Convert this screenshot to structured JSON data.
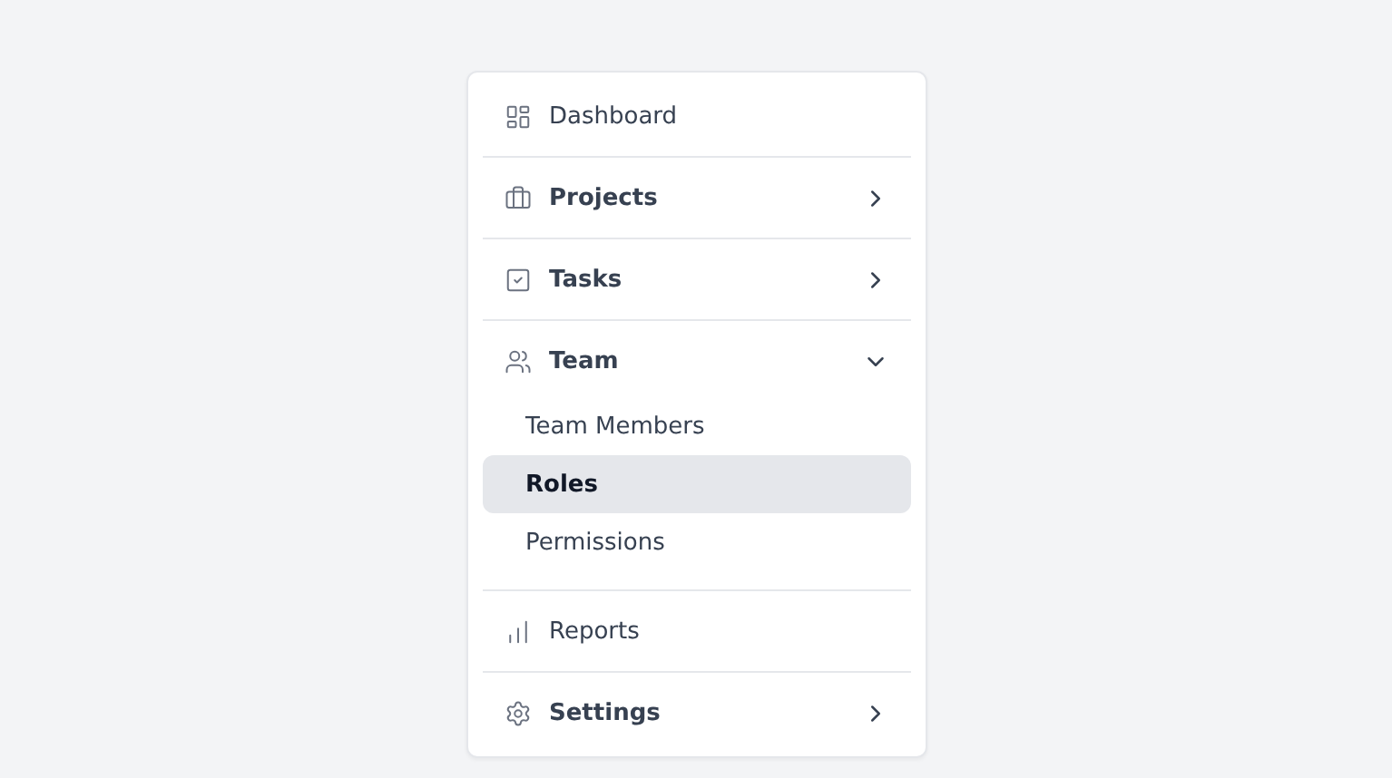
{
  "menu": [
    {
      "label": "Dashboard",
      "kind": "link"
    },
    {
      "label": "Projects",
      "kind": "group",
      "expanded": false
    },
    {
      "label": "Tasks",
      "kind": "group",
      "expanded": false
    },
    {
      "label": "Team",
      "kind": "group",
      "expanded": true,
      "children": [
        {
          "label": "Team Members",
          "selected": false
        },
        {
          "label": "Roles",
          "selected": true
        },
        {
          "label": "Permissions",
          "selected": false
        }
      ]
    },
    {
      "label": "Reports",
      "kind": "link"
    },
    {
      "label": "Settings",
      "kind": "group",
      "expanded": false
    }
  ]
}
